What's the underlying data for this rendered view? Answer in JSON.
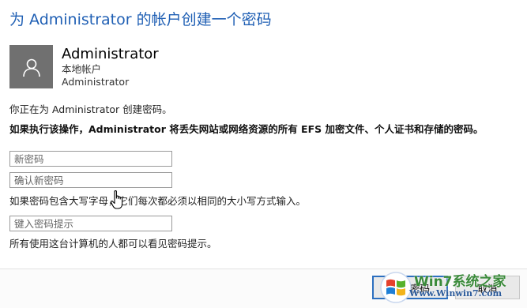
{
  "dialog": {
    "title": "为 Administrator 的帐户创建一个密码"
  },
  "account": {
    "avatar_icon": "user-icon",
    "name": "Administrator",
    "type": "本地帐户",
    "username": "Administrator"
  },
  "info": {
    "creating": "你正在为 Administrator 创建密码。",
    "warning": "如果执行该操作，Administrator 将丢失网站或网络资源的所有 EFS 加密文件、个人证书和存储的密码。"
  },
  "fields": {
    "new_password_placeholder": "新密码",
    "confirm_password_placeholder": "确认新密码",
    "hint_placeholder": "键入密码提示"
  },
  "notes": {
    "case_note": "如果密码包含大写字母，它们每次都必须以相同的大小写方式输入。",
    "hint_note": "所有使用这台计算机的人都可以看见密码提示。"
  },
  "buttons": {
    "create": "创建密码",
    "cancel": "取消"
  },
  "watermark": {
    "brand": "Win7系统之家",
    "url": "Www.Winwin7.com"
  },
  "colors": {
    "title": "#1f5fb4",
    "avatar_bg": "#707070",
    "primary_button_border": "#2c6fbf"
  }
}
